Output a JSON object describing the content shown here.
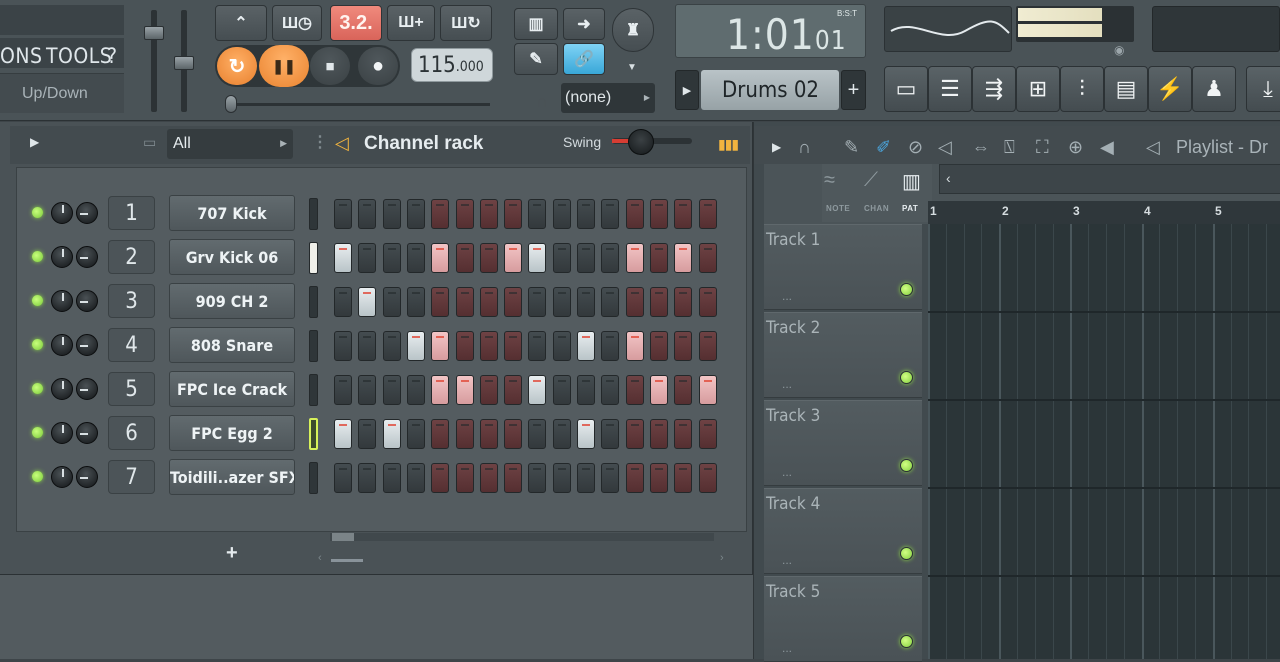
{
  "menu": {
    "left_text": "ONS",
    "tools": "TOOLS",
    "help": "?",
    "updown": "Up/Down"
  },
  "transport": {
    "mode_label": "3.2.",
    "tempo_main": "115",
    "tempo_decimal": ".000",
    "loop_icon": "loop-icon",
    "pause_icon": "pause-icon",
    "stop_icon": "stop-icon",
    "record_icon": "record-icon"
  },
  "time": {
    "main": "1:01",
    "small": "01",
    "label": "B:S:T"
  },
  "pattern": {
    "name": "Drums 02",
    "plus": "+",
    "none_label": "(none)"
  },
  "channel_rack": {
    "filter": "All",
    "title": "Channel rack",
    "swing_label": "Swing",
    "add": "+",
    "channels": [
      {
        "num": "1",
        "name": "707 Kick",
        "steps": [
          0,
          0,
          0,
          0,
          0,
          0,
          0,
          0,
          0,
          0,
          0,
          0,
          0,
          0,
          0,
          0
        ],
        "sel": "off"
      },
      {
        "num": "2",
        "name": "Grv Kick 06",
        "steps": [
          1,
          0,
          0,
          0,
          1,
          0,
          0,
          1,
          1,
          0,
          0,
          0,
          1,
          0,
          1,
          0
        ],
        "sel": "on"
      },
      {
        "num": "3",
        "name": "909 CH 2",
        "steps": [
          0,
          1,
          0,
          0,
          0,
          0,
          0,
          0,
          0,
          0,
          0,
          0,
          0,
          0,
          0,
          0
        ],
        "sel": "off"
      },
      {
        "num": "4",
        "name": "808 Snare",
        "steps": [
          0,
          0,
          0,
          1,
          1,
          0,
          0,
          0,
          0,
          0,
          1,
          0,
          1,
          0,
          0,
          0
        ],
        "sel": "off"
      },
      {
        "num": "5",
        "name": "FPC Ice Crack",
        "steps": [
          0,
          0,
          0,
          0,
          1,
          1,
          0,
          0,
          1,
          0,
          0,
          0,
          0,
          1,
          0,
          1
        ],
        "sel": "off"
      },
      {
        "num": "6",
        "name": "FPC Egg 2",
        "steps": [
          1,
          0,
          1,
          0,
          0,
          0,
          0,
          0,
          0,
          0,
          1,
          0,
          0,
          0,
          0,
          0
        ],
        "sel": "selected"
      },
      {
        "num": "7",
        "name": "Toidili..azer SFX",
        "steps": [
          0,
          0,
          0,
          0,
          0,
          0,
          0,
          0,
          0,
          0,
          0,
          0,
          0,
          0,
          0,
          0
        ],
        "sel": "off"
      }
    ]
  },
  "playlist": {
    "title": "Playlist - Dr",
    "modes": [
      "NOTE",
      "CHAN",
      "PAT"
    ],
    "ruler": [
      "1",
      "2",
      "3",
      "4",
      "5"
    ],
    "tracks": [
      "Track 1",
      "Track 2",
      "Track 3",
      "Track 4",
      "Track 5"
    ],
    "dots": "..."
  }
}
